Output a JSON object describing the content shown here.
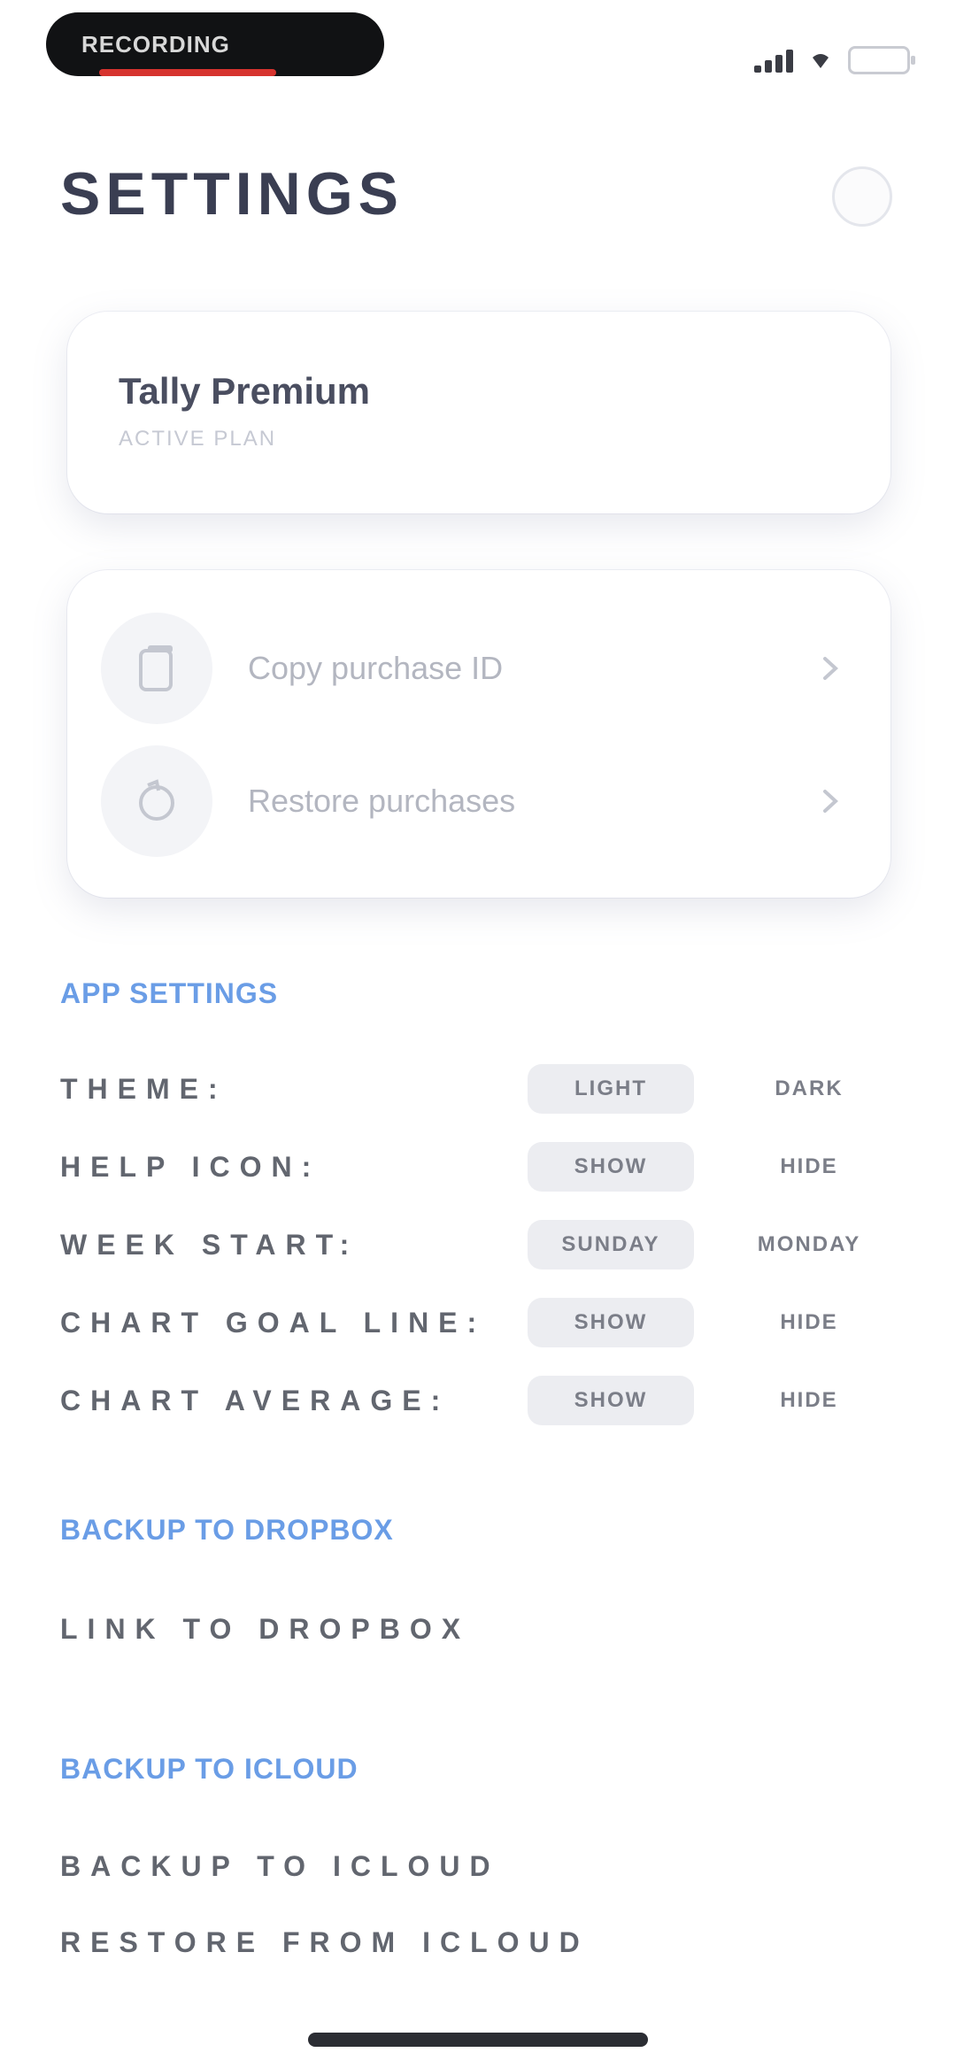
{
  "status_bar": {
    "pill_text": "RECORDING",
    "colors": {
      "pill": "#111214",
      "recording": "#d6332e",
      "battery": "#3fd35a"
    }
  },
  "header": {
    "title": "SETTINGS"
  },
  "premium": {
    "title": "Tally Premium",
    "subtitle": "ACTIVE PLAN"
  },
  "purchase_actions": [
    {
      "label": "Copy purchase ID",
      "icon": "clipboard-icon"
    },
    {
      "label": "Restore purchases",
      "icon": "restore-icon"
    }
  ],
  "app_settings": {
    "heading": "APP SETTINGS",
    "rows": [
      {
        "label": "THEME:",
        "options": [
          "LIGHT",
          "DARK"
        ],
        "selected": "LIGHT"
      },
      {
        "label": "HELP ICON:",
        "options": [
          "SHOW",
          "HIDE"
        ],
        "selected": "SHOW"
      },
      {
        "label": "WEEK START:",
        "options": [
          "SUNDAY",
          "MONDAY"
        ],
        "selected": "SUNDAY"
      },
      {
        "label": "CHART GOAL LINE:",
        "options": [
          "SHOW",
          "HIDE"
        ],
        "selected": "SHOW"
      },
      {
        "label": "CHART AVERAGE:",
        "options": [
          "SHOW",
          "HIDE"
        ],
        "selected": "SHOW"
      }
    ]
  },
  "dropbox": {
    "heading": "BACKUP TO DROPBOX",
    "link_label": "LINK TO DROPBOX"
  },
  "icloud": {
    "heading": "BACKUP TO ICLOUD",
    "backup_label": "BACKUP TO ICLOUD",
    "restore_label": "RESTORE FROM ICLOUD"
  },
  "colors": {
    "accent": "#6a9de6",
    "title": "#3a3e52"
  }
}
